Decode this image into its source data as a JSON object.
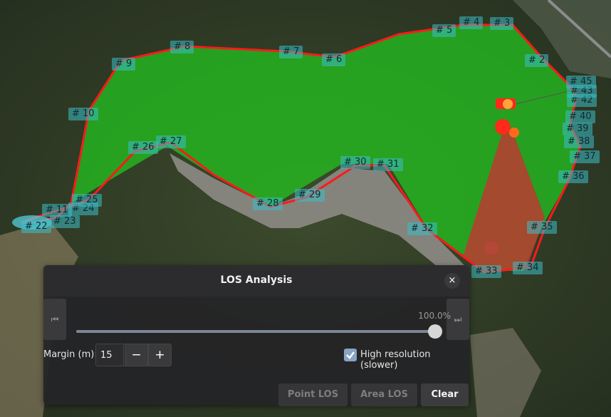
{
  "waypoint_labels": [
    "# 2",
    "# 3",
    "# 4",
    "# 5",
    "# 6",
    "# 7",
    "# 8",
    "# 9",
    "# 10",
    "# 11",
    "# 22",
    "# 23",
    "# 24",
    "# 25",
    "# 26",
    "# 27",
    "# 28",
    "# 29",
    "# 30",
    "# 31",
    "# 32",
    "# 33",
    "# 34",
    "# 35",
    "# 36",
    "# 37",
    "# 38",
    "# 39",
    "# 40",
    "# 42",
    "# 43",
    "# 45"
  ],
  "panel": {
    "title": "LOS Analysis",
    "close_glyph": "×",
    "prev_glyph": "⏮",
    "next_glyph": "⏭",
    "progress_text": "100.0%",
    "progress_value": 1.0,
    "margin_label": "Margin (m):",
    "margin_value": "15",
    "minus": "−",
    "plus": "+",
    "high_res_checked": true,
    "high_res_label": "High resolution (slower)",
    "point_los": "Point LOS",
    "area_los": "Area LOS",
    "clear": "Clear"
  },
  "colors": {
    "coverage_visible": "#22c81e",
    "coverage_blocked": "#c83232",
    "boundary": "#ff1a1a",
    "label_bg": "#3cbec8",
    "accent": "#8aa4c4"
  }
}
